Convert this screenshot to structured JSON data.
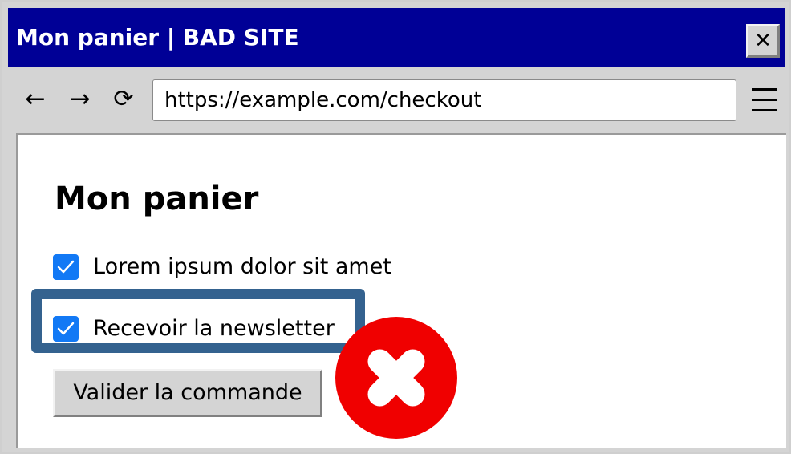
{
  "window": {
    "title": "Mon panier | BAD SITE",
    "close_glyph": "✕"
  },
  "toolbar": {
    "back_glyph": "←",
    "forward_glyph": "→",
    "reload_glyph": "⟳",
    "url": "https://example.com/checkout",
    "menu_icon": "hamburger-menu-icon"
  },
  "page": {
    "heading": "Mon panier",
    "checkboxes": [
      {
        "label": "Lorem ipsum dolor sit amet",
        "checked": true
      },
      {
        "label": "Recevoir la newsletter",
        "checked": true,
        "highlighted": true
      }
    ],
    "submit_label": "Valider la commande"
  },
  "overlay": {
    "icon": "error-cross-icon"
  },
  "colors": {
    "titlebar": "#000096",
    "chrome": "#d4d4d4",
    "checkbox": "#1279f5",
    "highlight_border": "#34628f",
    "error_red": "#f00000"
  }
}
